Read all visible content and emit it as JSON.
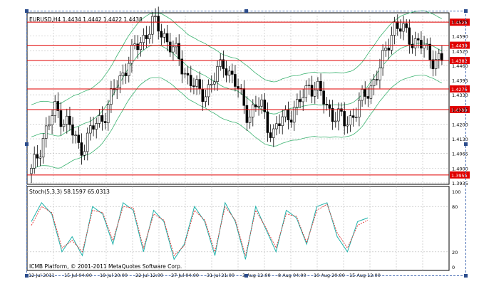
{
  "main_chart": {
    "header": "EURUSD,H4  1.4434 1.4442 1.4422 1.4438",
    "price_axis": [
      "1.4655",
      "1.4590",
      "1.4525",
      "1.4460",
      "1.4395",
      "1.4330",
      "1.4265",
      "1.4200",
      "1.4130",
      "1.4065",
      "1.4000",
      "1.3935"
    ],
    "levels": [
      {
        "label": "1.4525",
        "value": 1.4525
      },
      {
        "label": "1.4439",
        "value": 1.4439
      },
      {
        "label": "1.4382",
        "value": 1.4382
      },
      {
        "label": "1.4276",
        "value": 1.4276
      },
      {
        "label": "1.4199",
        "value": 1.4199
      },
      {
        "label": "1.3955",
        "value": 1.3955
      }
    ],
    "price_range": [
      1.392,
      1.456
    ],
    "colors": {
      "level": "#e00000",
      "bands": "#3cb371",
      "candle": "#000000",
      "grid": "#b8b8b8"
    }
  },
  "stoch": {
    "header": "Stoch(5,3,3) 58.1597 65.0313",
    "axis": [
      "100",
      "80",
      "20",
      "0"
    ],
    "colors": {
      "main": "#20b2aa",
      "signal": "#e03030"
    }
  },
  "watermark": "ICMB Platform, © 2001-2011 MetaQuotes Software Corp.",
  "time_axis": [
    "12 Jul 2011",
    "15 Jul 04:00",
    "19 Jul 20:00",
    "22 Jul 12:00",
    "27 Jul 04:00",
    "31 Jul 21:00",
    "3 Aug 12:00",
    "8 Aug 04:00",
    "10 Aug 20:00",
    "15 Aug 12:00"
  ],
  "chart_data": {
    "type": "line",
    "title": "EURUSD,H4",
    "close_approx": [
      1.396,
      1.41,
      1.42,
      1.415,
      1.405,
      1.412,
      1.418,
      1.428,
      1.438,
      1.445,
      1.452,
      1.448,
      1.44,
      1.432,
      1.425,
      1.43,
      1.438,
      1.428,
      1.418,
      1.422,
      1.41,
      1.418,
      1.42,
      1.43,
      1.425,
      1.418,
      1.415,
      1.42,
      1.428,
      1.436,
      1.452,
      1.448,
      1.445,
      1.44,
      1.438
    ],
    "stoch_main": [
      60,
      85,
      70,
      20,
      40,
      15,
      80,
      70,
      30,
      85,
      75,
      20,
      75,
      60,
      10,
      30,
      80,
      60,
      15,
      85,
      60,
      10,
      80,
      50,
      20,
      75,
      65,
      30,
      80,
      85,
      40,
      20,
      60,
      65
    ],
    "stoch_signal": [
      55,
      80,
      72,
      25,
      35,
      20,
      75,
      72,
      35,
      80,
      78,
      25,
      70,
      62,
      15,
      28,
      75,
      62,
      20,
      80,
      62,
      15,
      75,
      52,
      25,
      70,
      67,
      32,
      75,
      83,
      45,
      25,
      55,
      62
    ]
  }
}
